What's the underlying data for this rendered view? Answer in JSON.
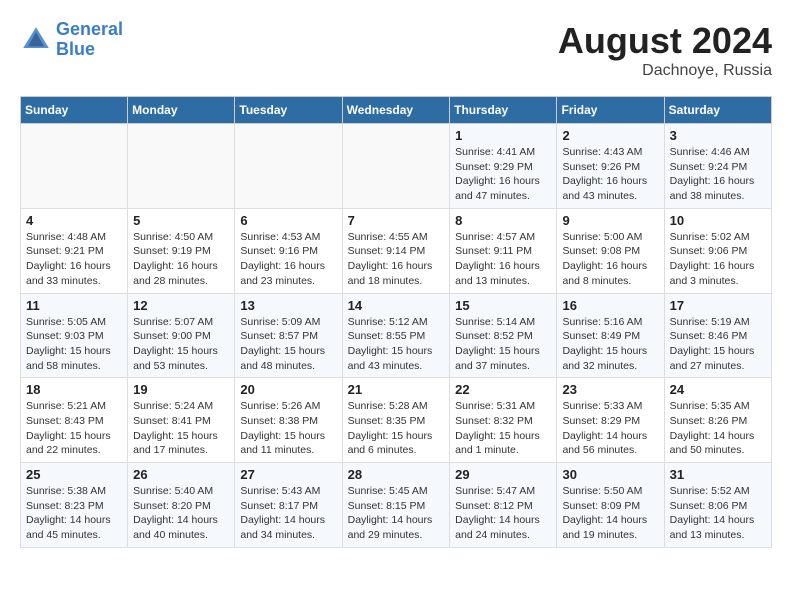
{
  "logo": {
    "line1": "General",
    "line2": "Blue"
  },
  "title": {
    "month_year": "August 2024",
    "location": "Dachnoye, Russia"
  },
  "days_of_week": [
    "Sunday",
    "Monday",
    "Tuesday",
    "Wednesday",
    "Thursday",
    "Friday",
    "Saturday"
  ],
  "weeks": [
    [
      {
        "num": "",
        "info": ""
      },
      {
        "num": "",
        "info": ""
      },
      {
        "num": "",
        "info": ""
      },
      {
        "num": "",
        "info": ""
      },
      {
        "num": "1",
        "info": "Sunrise: 4:41 AM\nSunset: 9:29 PM\nDaylight: 16 hours\nand 47 minutes."
      },
      {
        "num": "2",
        "info": "Sunrise: 4:43 AM\nSunset: 9:26 PM\nDaylight: 16 hours\nand 43 minutes."
      },
      {
        "num": "3",
        "info": "Sunrise: 4:46 AM\nSunset: 9:24 PM\nDaylight: 16 hours\nand 38 minutes."
      }
    ],
    [
      {
        "num": "4",
        "info": "Sunrise: 4:48 AM\nSunset: 9:21 PM\nDaylight: 16 hours\nand 33 minutes."
      },
      {
        "num": "5",
        "info": "Sunrise: 4:50 AM\nSunset: 9:19 PM\nDaylight: 16 hours\nand 28 minutes."
      },
      {
        "num": "6",
        "info": "Sunrise: 4:53 AM\nSunset: 9:16 PM\nDaylight: 16 hours\nand 23 minutes."
      },
      {
        "num": "7",
        "info": "Sunrise: 4:55 AM\nSunset: 9:14 PM\nDaylight: 16 hours\nand 18 minutes."
      },
      {
        "num": "8",
        "info": "Sunrise: 4:57 AM\nSunset: 9:11 PM\nDaylight: 16 hours\nand 13 minutes."
      },
      {
        "num": "9",
        "info": "Sunrise: 5:00 AM\nSunset: 9:08 PM\nDaylight: 16 hours\nand 8 minutes."
      },
      {
        "num": "10",
        "info": "Sunrise: 5:02 AM\nSunset: 9:06 PM\nDaylight: 16 hours\nand 3 minutes."
      }
    ],
    [
      {
        "num": "11",
        "info": "Sunrise: 5:05 AM\nSunset: 9:03 PM\nDaylight: 15 hours\nand 58 minutes."
      },
      {
        "num": "12",
        "info": "Sunrise: 5:07 AM\nSunset: 9:00 PM\nDaylight: 15 hours\nand 53 minutes."
      },
      {
        "num": "13",
        "info": "Sunrise: 5:09 AM\nSunset: 8:57 PM\nDaylight: 15 hours\nand 48 minutes."
      },
      {
        "num": "14",
        "info": "Sunrise: 5:12 AM\nSunset: 8:55 PM\nDaylight: 15 hours\nand 43 minutes."
      },
      {
        "num": "15",
        "info": "Sunrise: 5:14 AM\nSunset: 8:52 PM\nDaylight: 15 hours\nand 37 minutes."
      },
      {
        "num": "16",
        "info": "Sunrise: 5:16 AM\nSunset: 8:49 PM\nDaylight: 15 hours\nand 32 minutes."
      },
      {
        "num": "17",
        "info": "Sunrise: 5:19 AM\nSunset: 8:46 PM\nDaylight: 15 hours\nand 27 minutes."
      }
    ],
    [
      {
        "num": "18",
        "info": "Sunrise: 5:21 AM\nSunset: 8:43 PM\nDaylight: 15 hours\nand 22 minutes."
      },
      {
        "num": "19",
        "info": "Sunrise: 5:24 AM\nSunset: 8:41 PM\nDaylight: 15 hours\nand 17 minutes."
      },
      {
        "num": "20",
        "info": "Sunrise: 5:26 AM\nSunset: 8:38 PM\nDaylight: 15 hours\nand 11 minutes."
      },
      {
        "num": "21",
        "info": "Sunrise: 5:28 AM\nSunset: 8:35 PM\nDaylight: 15 hours\nand 6 minutes."
      },
      {
        "num": "22",
        "info": "Sunrise: 5:31 AM\nSunset: 8:32 PM\nDaylight: 15 hours\nand 1 minute."
      },
      {
        "num": "23",
        "info": "Sunrise: 5:33 AM\nSunset: 8:29 PM\nDaylight: 14 hours\nand 56 minutes."
      },
      {
        "num": "24",
        "info": "Sunrise: 5:35 AM\nSunset: 8:26 PM\nDaylight: 14 hours\nand 50 minutes."
      }
    ],
    [
      {
        "num": "25",
        "info": "Sunrise: 5:38 AM\nSunset: 8:23 PM\nDaylight: 14 hours\nand 45 minutes."
      },
      {
        "num": "26",
        "info": "Sunrise: 5:40 AM\nSunset: 8:20 PM\nDaylight: 14 hours\nand 40 minutes."
      },
      {
        "num": "27",
        "info": "Sunrise: 5:43 AM\nSunset: 8:17 PM\nDaylight: 14 hours\nand 34 minutes."
      },
      {
        "num": "28",
        "info": "Sunrise: 5:45 AM\nSunset: 8:15 PM\nDaylight: 14 hours\nand 29 minutes."
      },
      {
        "num": "29",
        "info": "Sunrise: 5:47 AM\nSunset: 8:12 PM\nDaylight: 14 hours\nand 24 minutes."
      },
      {
        "num": "30",
        "info": "Sunrise: 5:50 AM\nSunset: 8:09 PM\nDaylight: 14 hours\nand 19 minutes."
      },
      {
        "num": "31",
        "info": "Sunrise: 5:52 AM\nSunset: 8:06 PM\nDaylight: 14 hours\nand 13 minutes."
      }
    ]
  ]
}
